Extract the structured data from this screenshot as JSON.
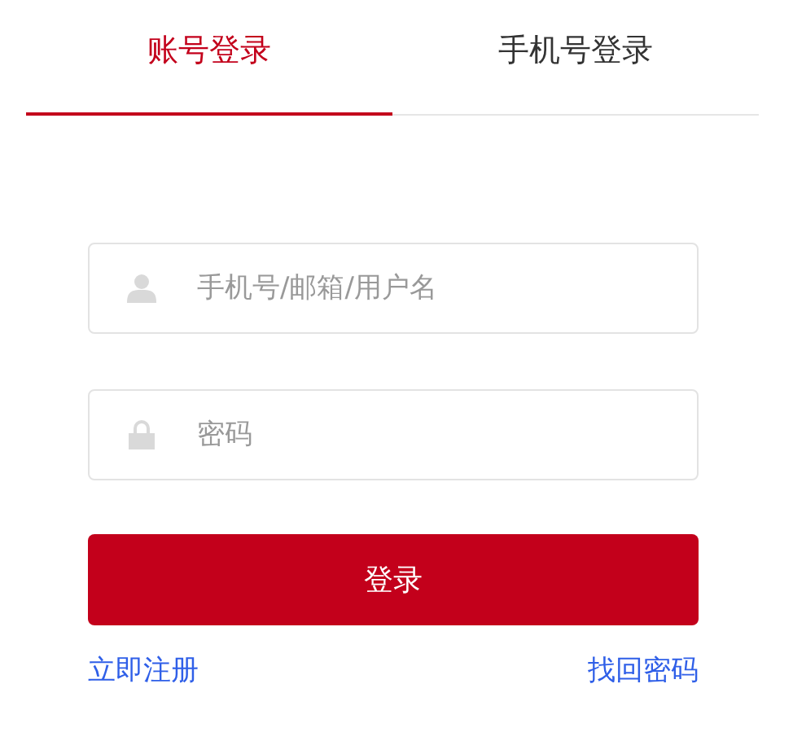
{
  "tabs": [
    {
      "label": "账号登录",
      "selected": true
    },
    {
      "label": "手机号登录",
      "selected": false
    }
  ],
  "fields": [
    {
      "kind": "user",
      "placeholder": "手机号/邮箱/用户名"
    },
    {
      "kind": "password",
      "placeholder": "密码"
    }
  ],
  "submit": "登录",
  "links": [
    "立即注册",
    "找回密码"
  ]
}
